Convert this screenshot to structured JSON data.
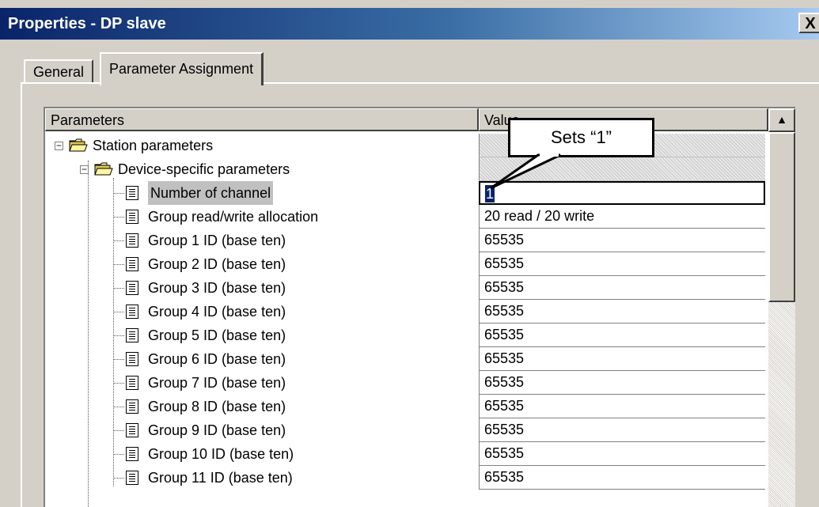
{
  "window": {
    "title": "Properties - DP slave",
    "close_glyph": "X"
  },
  "tabs": [
    {
      "label": "General",
      "active": false
    },
    {
      "label": "Parameter Assignment",
      "active": true
    }
  ],
  "table": {
    "col_parameters": "Parameters",
    "col_value": "Value",
    "rows": [
      {
        "label": "Station parameters",
        "value": "",
        "icon": "folder-icon",
        "expander": "minus"
      },
      {
        "label": "Device-specific parameters",
        "value": "",
        "icon": "folder-icon",
        "expander": "minus"
      },
      {
        "label": "Number of channel",
        "value": "1",
        "icon": "document-icon",
        "selected": true
      },
      {
        "label": "Group read/write allocation",
        "value": "20 read / 20 write",
        "icon": "document-icon"
      },
      {
        "label": "Group 1 ID (base ten)",
        "value": "65535",
        "icon": "document-icon"
      },
      {
        "label": "Group 2 ID (base ten)",
        "value": "65535",
        "icon": "document-icon"
      },
      {
        "label": "Group 3 ID (base ten)",
        "value": "65535",
        "icon": "document-icon"
      },
      {
        "label": "Group 4 ID (base ten)",
        "value": "65535",
        "icon": "document-icon"
      },
      {
        "label": "Group 5 ID (base ten)",
        "value": "65535",
        "icon": "document-icon"
      },
      {
        "label": "Group 6 ID (base ten)",
        "value": "65535",
        "icon": "document-icon"
      },
      {
        "label": "Group 7 ID (base ten)",
        "value": "65535",
        "icon": "document-icon"
      },
      {
        "label": "Group 8 ID (base ten)",
        "value": "65535",
        "icon": "document-icon"
      },
      {
        "label": "Group 9 ID (base ten)",
        "value": "65535",
        "icon": "document-icon"
      },
      {
        "label": "Group 10 ID (base ten)",
        "value": "65535",
        "icon": "document-icon"
      },
      {
        "label": "Group 11 ID (base ten)",
        "value": "65535",
        "icon": "document-icon"
      }
    ]
  },
  "callout": {
    "text": "Sets “1”"
  },
  "scrollbar": {
    "up_glyph": "▲"
  },
  "colors": {
    "titlebar_start": "#0a246a",
    "titlebar_end": "#a6caf0",
    "face": "#d4d0c8",
    "selection": "#0a246a"
  }
}
